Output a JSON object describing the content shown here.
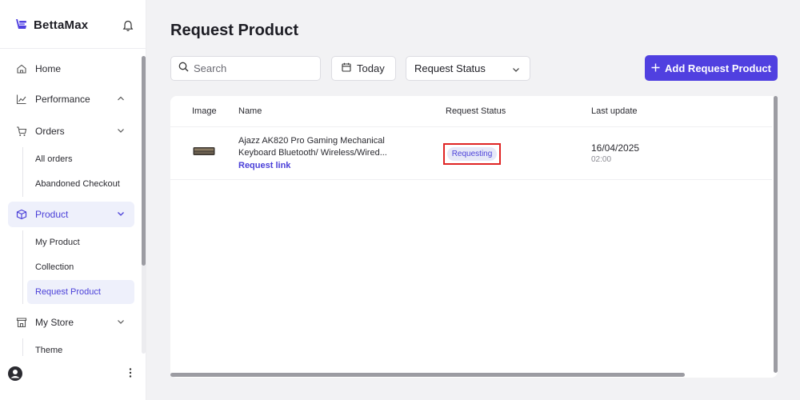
{
  "sidebar": {
    "brand": "BettaMax",
    "items": [
      {
        "label": "Home"
      },
      {
        "label": "Performance"
      },
      {
        "label": "Orders"
      },
      {
        "label": "Product"
      },
      {
        "label": "My Store"
      }
    ],
    "orders_sub": [
      "All orders",
      "Abandoned Checkout"
    ],
    "product_sub": [
      "My Product",
      "Collection",
      "Request Product"
    ],
    "store_sub": [
      "Theme"
    ]
  },
  "main": {
    "title": "Request Product",
    "search_placeholder": "Search",
    "date_filter": "Today",
    "status_filter": "Request Status",
    "add_button": "Add Request Product",
    "table": {
      "columns": [
        "Image",
        "Name",
        "Request Status",
        "Last update"
      ],
      "rows": [
        {
          "name": "Ajazz AK820 Pro Gaming Mechanical Keyboard Bluetooth/ Wireless/Wired...",
          "link": "Request link",
          "status": "Requesting",
          "date": "16/04/2025",
          "time": "02:00"
        }
      ]
    }
  },
  "colors": {
    "accent": "#5040e0",
    "active_bg": "#eef0fb",
    "highlight_border": "#e02424"
  }
}
